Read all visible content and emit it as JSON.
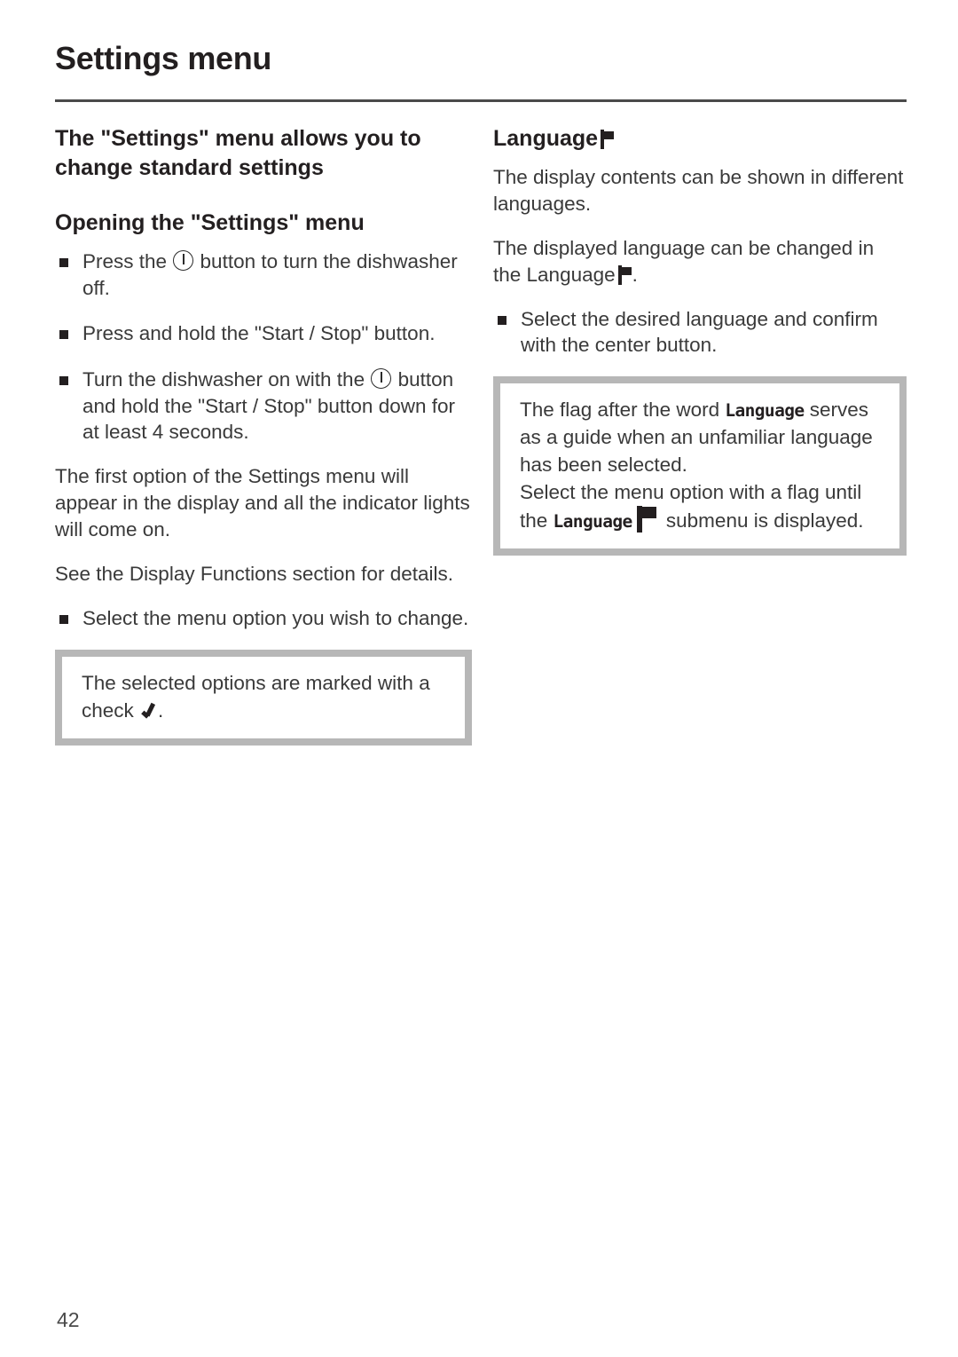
{
  "document": {
    "header_title": "Settings menu",
    "page_number": "42"
  },
  "left_column": {
    "heading_1": "The \"Settings\" menu allows you to change standard settings",
    "heading_2": "Opening the \"Settings\" menu",
    "bullets": [
      {
        "text_before_icon": "Press the ",
        "icon": "power-button-icon",
        "text_after_icon": " button to turn the dishwasher off."
      },
      {
        "text_before_icon": "Press and hold the \"Start / Stop\" button.",
        "icon": "",
        "text_after_icon": ""
      },
      {
        "text_before_icon": "Turn the dishwasher on with the ",
        "icon": "power-button-icon",
        "text_after_icon": " button and hold the \"Start / Stop\" button down for at least 4 seconds."
      }
    ],
    "paragraph_1": "The first option of the Settings menu will appear in the display and all the indicator lights will come on.",
    "paragraph_2": "See the Display Functions section for details.",
    "bullet_after": "Select the menu option you wish to change.",
    "note_box": {
      "text_before_check": "The selected options are marked with a  check ",
      "check_icon": "check-mark-icon",
      "text_after_check": "."
    }
  },
  "right_column": {
    "heading": "Language",
    "heading_icon": "flag-icon",
    "paragraph_1": "The display contents can be shown in different languages.",
    "paragraph_2_before_icon": "The displayed language can be changed in the Language",
    "paragraph_2_icon": "flag-icon",
    "paragraph_2_after_icon": ".",
    "bullet": "Select the desired language and confirm with the center button.",
    "note_box": {
      "line_1_before_lcd": "The flag after the word ",
      "line_1_lcd": "Language",
      "line_2": "serves as a guide when an unfamiliar language has been selected.",
      "line_3_before_lcd": "Select the menu option with a flag until the ",
      "line_3_lcd": "Language",
      "line_3_icon": "flag-icon",
      "line_3_after_icon": " submenu is displayed."
    }
  },
  "colors": {
    "text": "#3a3a3a",
    "heading": "#231f20",
    "rule": "#4a4a4a",
    "note_border": "#b7b7b7"
  }
}
